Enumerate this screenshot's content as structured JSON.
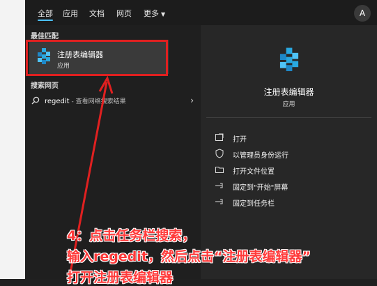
{
  "tabs": [
    "全部",
    "应用",
    "文档",
    "网页",
    "更多"
  ],
  "avatar_letter": "A",
  "best_match": {
    "section_title": "最佳匹配",
    "name": "注册表编辑器",
    "type": "应用"
  },
  "web_search": {
    "section_title": "搜索网页",
    "query": "regedit",
    "suffix": " - 查看网络搜索结果"
  },
  "detail": {
    "name": "注册表编辑器",
    "type": "应用",
    "actions": [
      {
        "label": "打开",
        "icon": "open-icon"
      },
      {
        "label": "以管理员身份运行",
        "icon": "shield-admin-icon"
      },
      {
        "label": "打开文件位置",
        "icon": "folder-icon"
      },
      {
        "label": "固定到\"开始\"屏幕",
        "icon": "pin-icon"
      },
      {
        "label": "固定到任务栏",
        "icon": "pin-icon"
      }
    ]
  },
  "annotation": {
    "line1": "4：点击任务栏搜索，",
    "line2": "输入regedit，然后点击“注册表编辑器”",
    "line3": "打开注册表编辑器",
    "color": "#ff3a3a"
  },
  "accent_color": "#4cc2ff",
  "highlight_color": "#e02020"
}
